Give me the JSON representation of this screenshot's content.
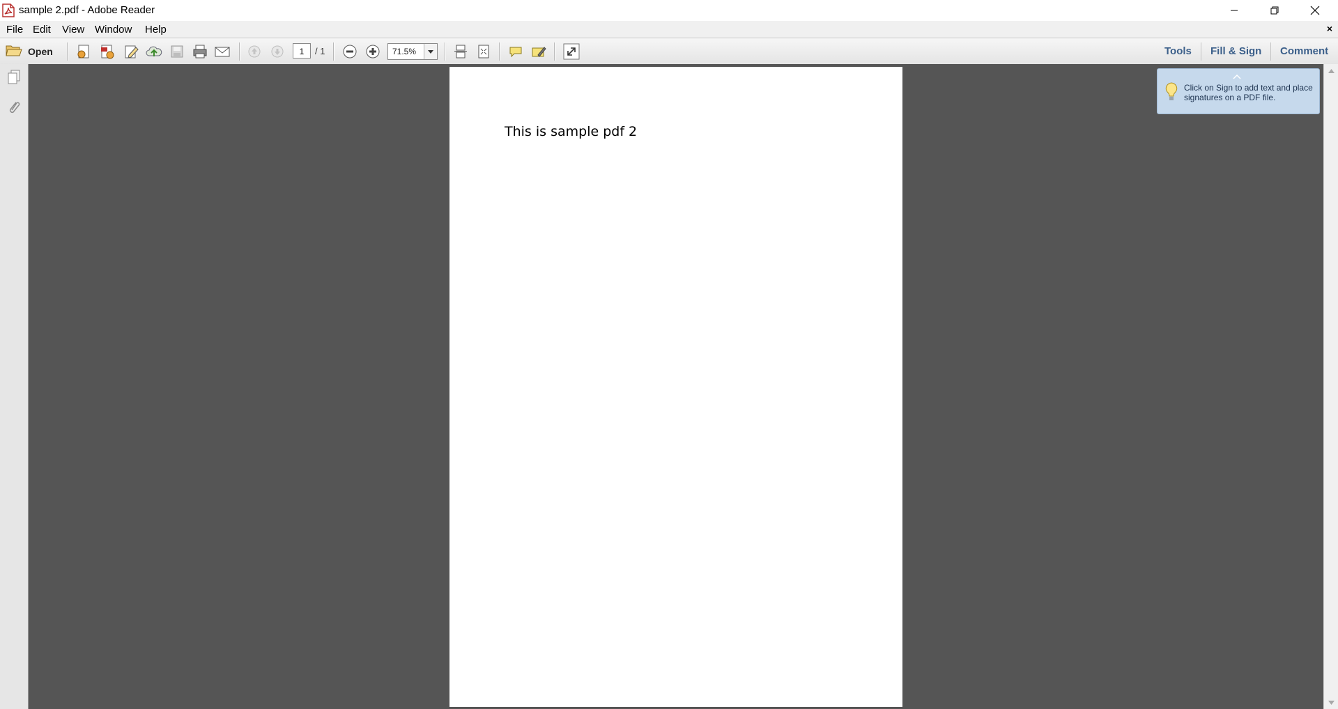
{
  "window": {
    "title": "sample 2.pdf - Adobe Reader",
    "app_icon": "adobe-pdf-icon",
    "controls": [
      "minimize-icon",
      "restore-icon",
      "close-icon"
    ]
  },
  "menubar": {
    "items": [
      "File",
      "Edit",
      "View",
      "Window",
      "Help"
    ],
    "close_document": "×"
  },
  "toolbar": {
    "open_label": "Open",
    "page_number": "1",
    "page_total": "/ 1",
    "zoom_value": "71.5%",
    "pane_links": [
      "Tools",
      "Fill & Sign",
      "Comment"
    ]
  },
  "tooltip": {
    "text": "Click on Sign to add text and place signatures on a PDF file."
  },
  "document": {
    "text": "This is sample pdf 2"
  },
  "colors": {
    "workspace": "#555555",
    "pane_link": "#3b5f8a",
    "tooltip_bg": "#c6d9ec"
  }
}
